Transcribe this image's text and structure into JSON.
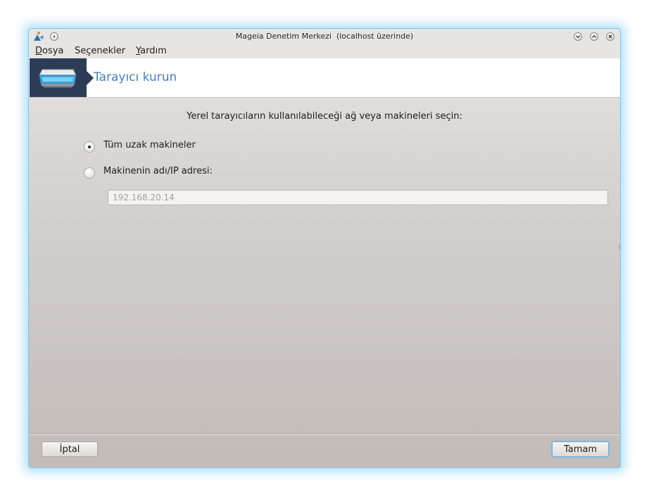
{
  "window": {
    "title": "Mageia Denetim Merkezi  (localhost üzerinde)"
  },
  "menubar": {
    "items": [
      {
        "accel": "D",
        "rest": "osya"
      },
      {
        "pre": "Se",
        "accel": "ç",
        "rest": "enekler"
      },
      {
        "accel": "Y",
        "rest": "ardım"
      }
    ]
  },
  "header": {
    "title": "Tarayıcı kurun",
    "icon": "scanner-icon",
    "accent": "#4a7fb8",
    "icon_bg": "#2d3c55"
  },
  "form": {
    "prompt": "Yerel tarayıcıların kullanılabileceği ağ veya makineleri seçin:",
    "options": [
      {
        "label": "Tüm uzak makineler",
        "selected": true
      },
      {
        "label": "Makinenin adı/IP adresi:",
        "selected": false
      }
    ],
    "ip_value": "192.168.20.14"
  },
  "buttons": {
    "cancel_label": "İptal",
    "ok_label": "Tamam"
  }
}
